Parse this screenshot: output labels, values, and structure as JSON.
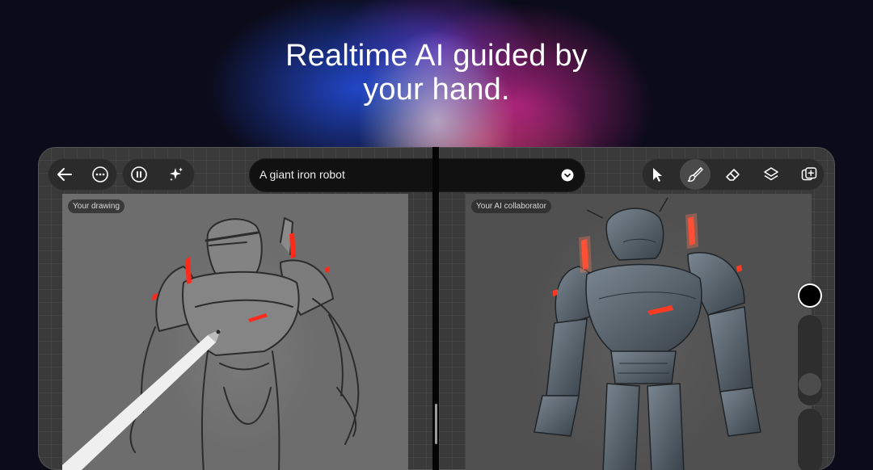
{
  "hero": {
    "headline_line1": "Realtime AI guided by",
    "headline_line2": "your hand."
  },
  "toolbar_left": {
    "back": "back-arrow-icon",
    "more": "more-options-icon",
    "pause": "pause-icon",
    "sparkle": "sparkle-icon"
  },
  "prompt": {
    "text": "A giant iron robot",
    "dropdown_icon": "chevron-down-icon"
  },
  "toolbar_right": {
    "tools": [
      "select-cursor-icon",
      "brush-icon",
      "eraser-icon",
      "layers-icon",
      "add-canvas-icon"
    ],
    "active_tool": "brush-icon"
  },
  "canvases": {
    "left_label": "Your drawing",
    "right_label": "Your AI collaborator"
  },
  "colors": {
    "accent_red": "#ff2a1a",
    "current_brush": "#000000"
  }
}
